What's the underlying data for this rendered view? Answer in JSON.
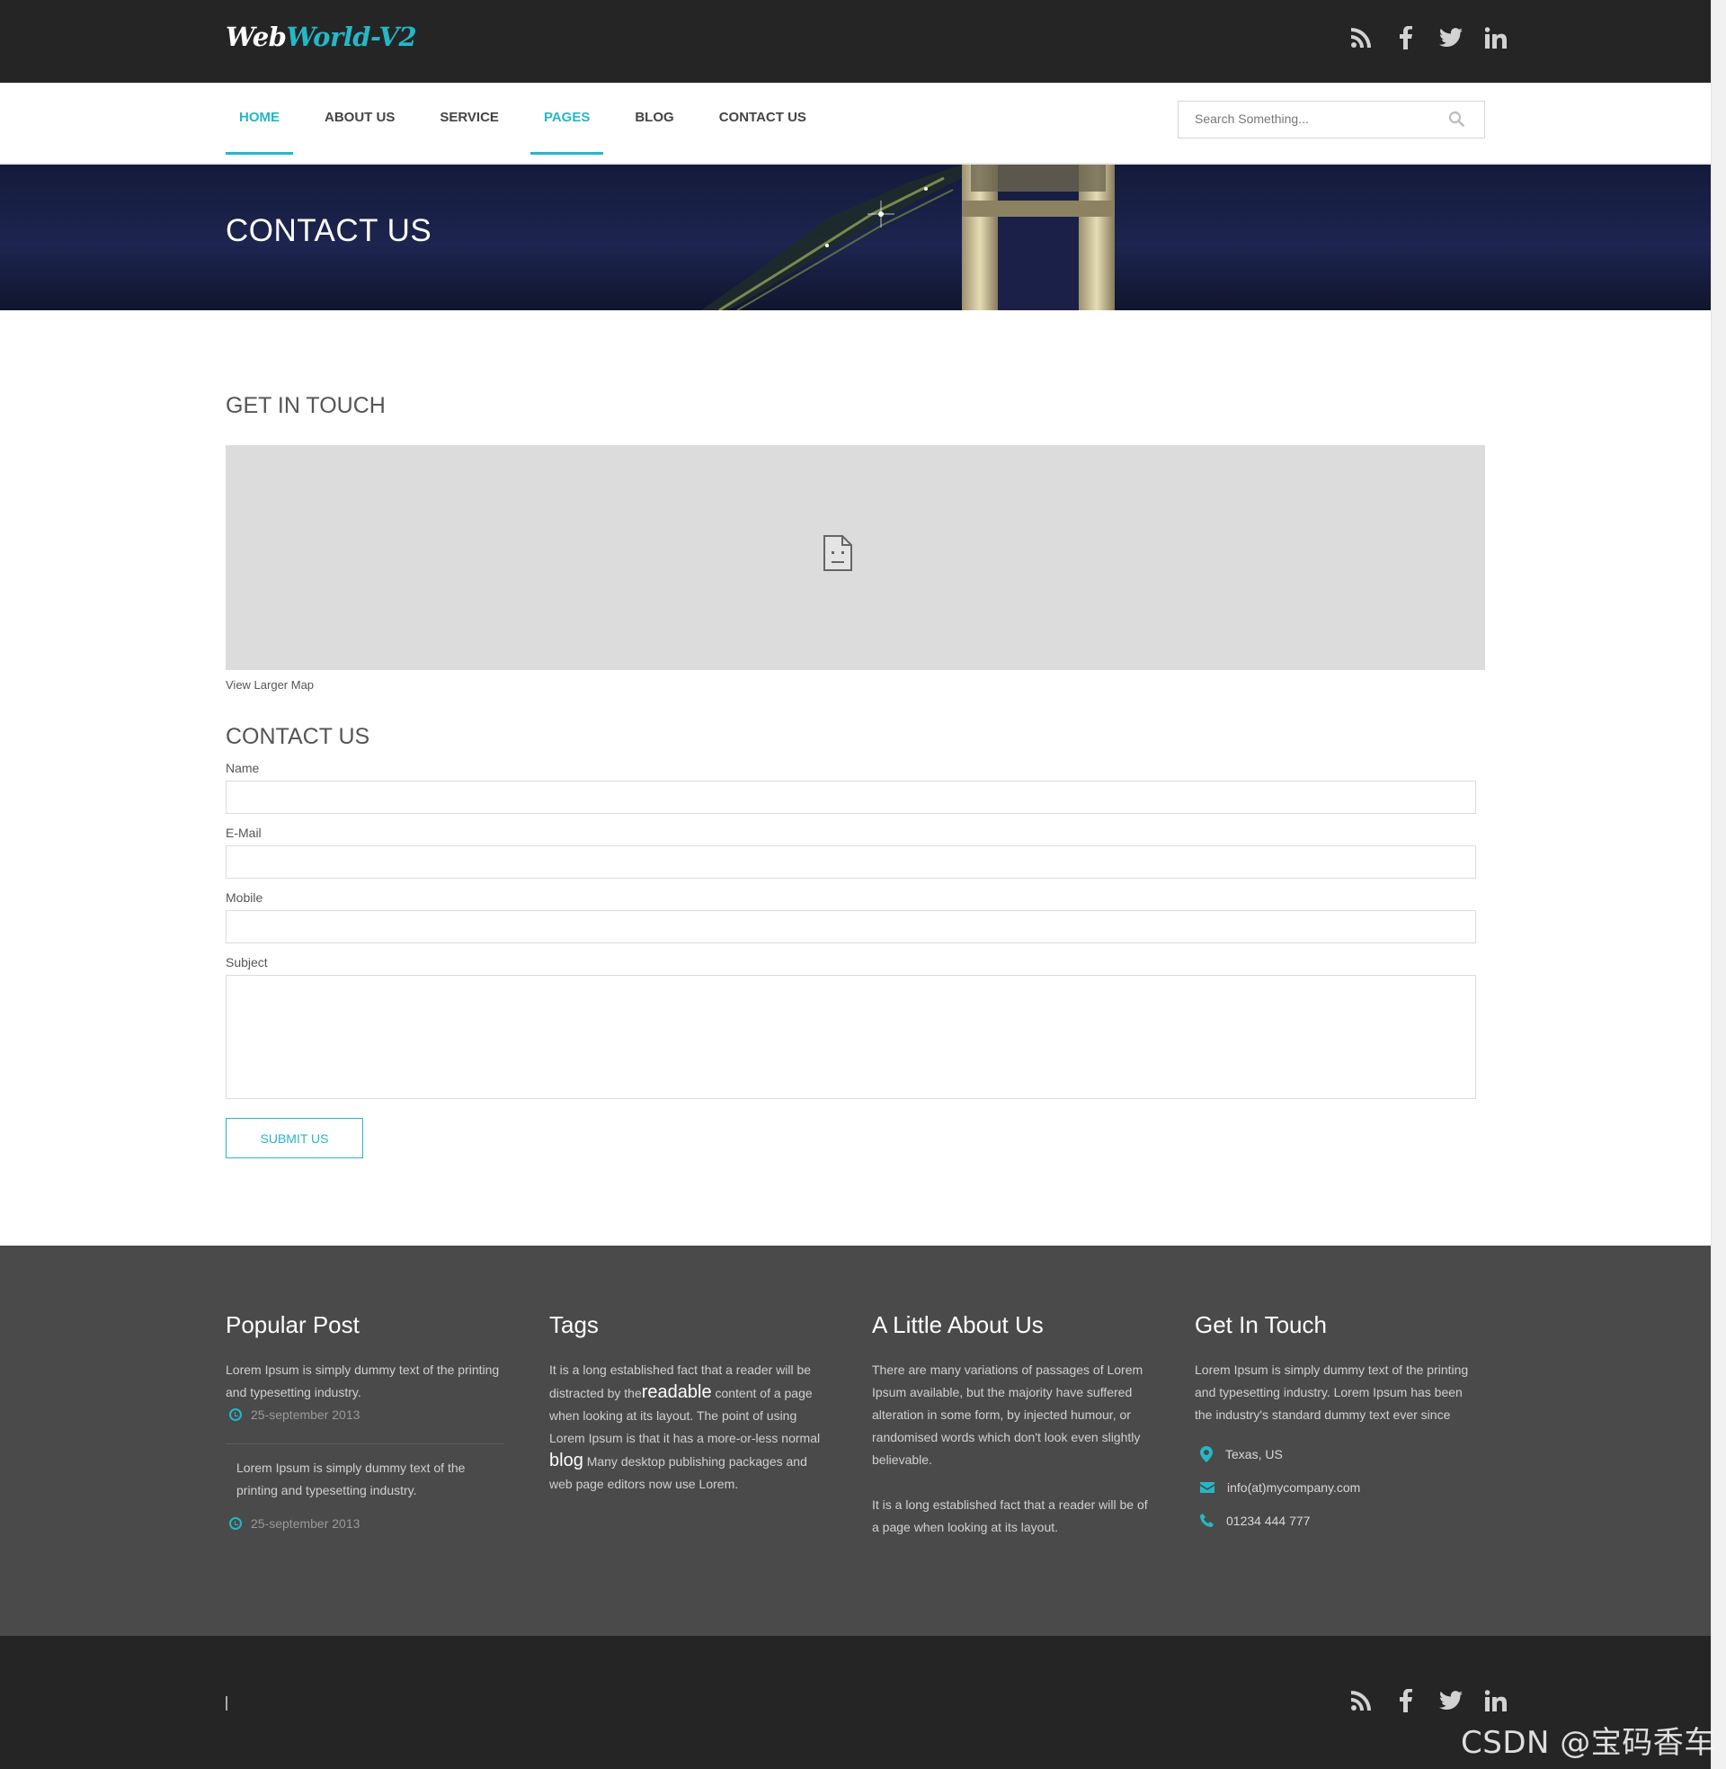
{
  "brand": {
    "part1": "Web",
    "part2": "World-V2"
  },
  "social_icons": [
    "rss-icon",
    "facebook-icon",
    "twitter-icon",
    "linkedin-icon"
  ],
  "nav": {
    "items": [
      {
        "label": "HOME"
      },
      {
        "label": "ABOUT US"
      },
      {
        "label": "SERVICE"
      },
      {
        "label": "PAGES"
      },
      {
        "label": "BLOG"
      },
      {
        "label": "CONTACT US"
      }
    ],
    "active": [
      "HOME",
      "PAGES"
    ]
  },
  "search": {
    "placeholder": "Search Something..."
  },
  "banner": {
    "title": "CONTACT US"
  },
  "get_in_touch": {
    "title": "GET IN TOUCH",
    "map_link": "View Larger Map"
  },
  "contact_form": {
    "title": "CONTACT US",
    "name_label": "Name",
    "email_label": "E-Mail",
    "mobile_label": "Mobile",
    "subject_label": "Subject",
    "submit_label": "SUBMIT US"
  },
  "footer": {
    "popular": {
      "title": "Popular Post",
      "posts": [
        {
          "text": "Lorem Ipsum is simply dummy text of the printing and typesetting industry.",
          "date": "25-september 2013"
        },
        {
          "text": "Lorem Ipsum is simply dummy text of the printing and typesetting industry.",
          "date": "25-september 2013"
        }
      ]
    },
    "tags": {
      "title": "Tags",
      "p1": "It is a long established fact that a reader will be distracted by the",
      "w1": "readable",
      "p2": " content of a page when looking at its layout. The point of using Lorem Ipsum is that it has a more-or-less normal ",
      "w2": "blog",
      "p3": " Many desktop publishing packages and web page editors now use Lorem."
    },
    "about": {
      "title": "A Little About Us",
      "p1": "There are many variations of passages of Lorem Ipsum available, but the majority have suffered alteration in some form, by injected humour, or randomised words which don't look even slightly believable.",
      "p2": "It is a long established fact that a reader will be of a page when looking at its layout."
    },
    "touch": {
      "title": "Get In Touch",
      "text": "Lorem Ipsum is simply dummy text of the printing and typesetting industry. Lorem Ipsum has been the industry's standard dummy text ever since",
      "location": "Texas, US",
      "email": "info(at)mycompany.com",
      "phone": "01234 444 777"
    }
  },
  "watermark": "CSDN @宝码香车",
  "colors": {
    "accent": "#25b7c6",
    "dark_bar": "#252526",
    "footer_bg": "#4a4a4b"
  }
}
